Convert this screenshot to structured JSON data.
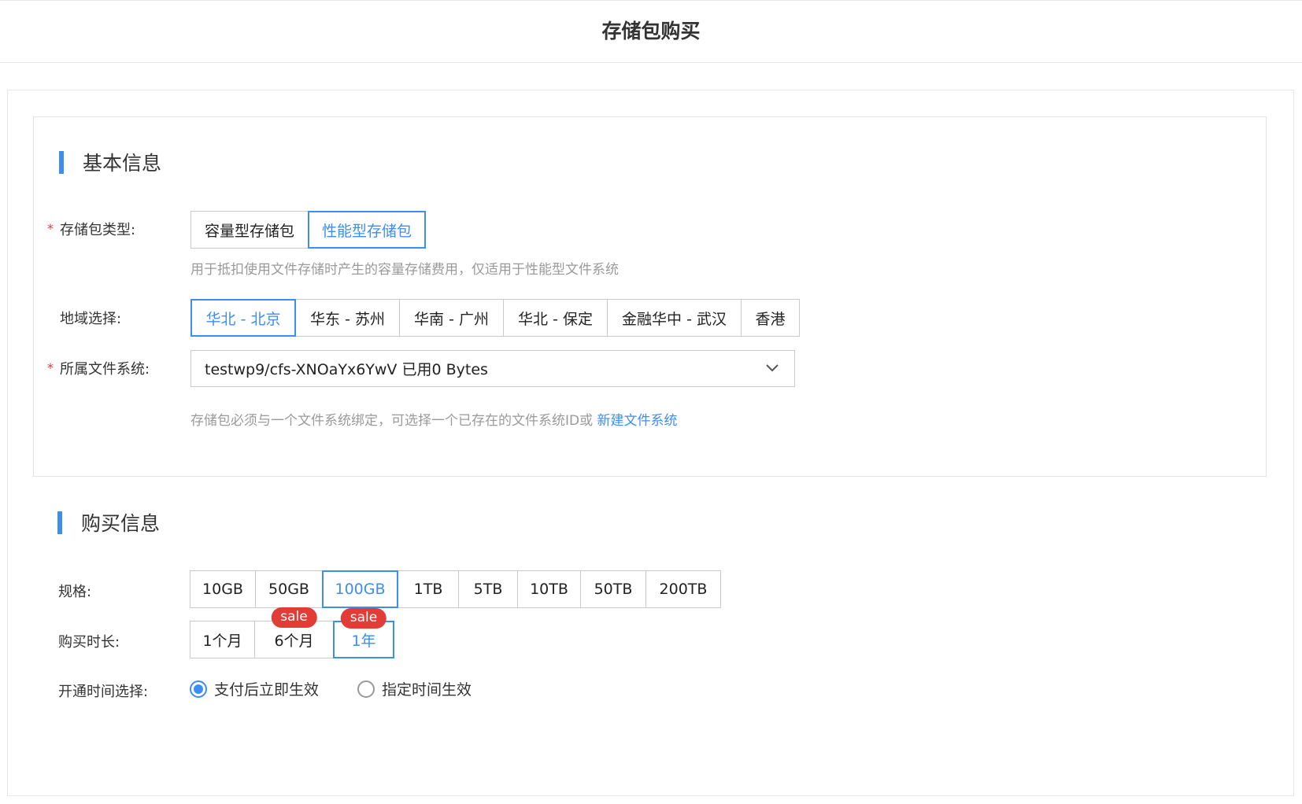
{
  "header": {
    "title": "存储包购买"
  },
  "basic_info": {
    "section_title": "基本信息",
    "package_type": {
      "label": "存储包类型:",
      "required_mark": "*",
      "options": [
        "容量型存储包",
        "性能型存储包"
      ],
      "selected": "性能型存储包",
      "hint": "用于抵扣使用文件存储时产生的容量存储费用，仅适用于性能型文件系统"
    },
    "region": {
      "label": "地域选择:",
      "options": [
        "华北 - 北京",
        "华东 - 苏州",
        "华南 - 广州",
        "华北 - 保定",
        "金融华中 - 武汉",
        "香港"
      ],
      "selected": "华北 - 北京"
    },
    "file_system": {
      "label": "所属文件系统:",
      "required_mark": "*",
      "value": "testwp9/cfs-XNOaYx6YwV 已用0 Bytes",
      "hint": "存储包必须与一个文件系统绑定，可选择一个已存在的文件系统ID或",
      "hint_link": "新建文件系统"
    }
  },
  "purchase_info": {
    "section_title": "购买信息",
    "spec": {
      "label": "规格:",
      "options": [
        "10GB",
        "50GB",
        "100GB",
        "1TB",
        "5TB",
        "10TB",
        "50TB",
        "200TB"
      ],
      "selected": "100GB"
    },
    "duration": {
      "label": "购买时长:",
      "options": [
        "1个月",
        "6个月",
        "1年"
      ],
      "badges": [
        "",
        "sale",
        "sale"
      ],
      "selected": "1年"
    },
    "activation": {
      "label": "开通时间选择:",
      "options": [
        "支付后立即生效",
        "指定时间生效"
      ],
      "selected": "支付后立即生效"
    }
  },
  "colors": {
    "accent": "#3d8ef0",
    "required": "#e0353a",
    "sale_badge": "#e13c36",
    "hint": "#9a9a9a"
  }
}
